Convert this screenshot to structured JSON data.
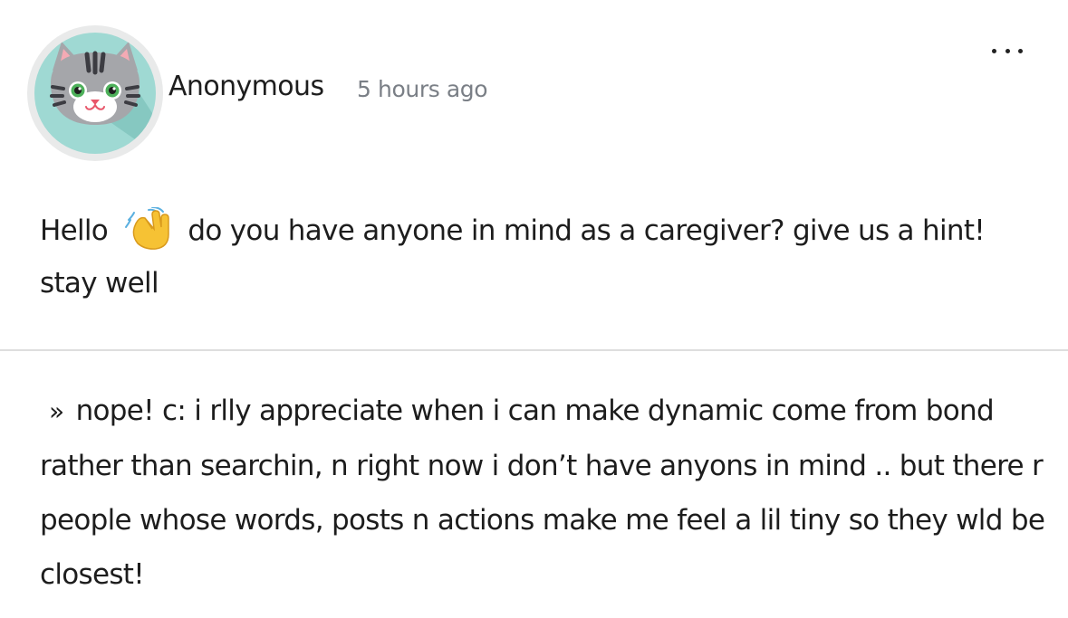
{
  "post": {
    "author": "Anonymous",
    "timestamp": "5 hours ago",
    "avatar_icon": "cat-face-icon",
    "more_icon": "more-options-icon"
  },
  "question": {
    "greeting": "Hello",
    "emoji": "waving-hand-emoji",
    "text_after_emoji": "do you have anyone in mind as a caregiver? give us a hint! stay well"
  },
  "answer": {
    "marker": "»",
    "text": "nope! c: i rlly appreciate when i can make dynamic come from bond rather than searchin, n right now i don’t have anyons in mind .. but there r people whose words, posts n actions make me feel a lil tiny so they wld be closest!"
  },
  "colors": {
    "avatar_bg": "#9fd9d3",
    "ring": "#e9eaea",
    "muted_text": "#7a7f86",
    "divider": "#dedede"
  }
}
